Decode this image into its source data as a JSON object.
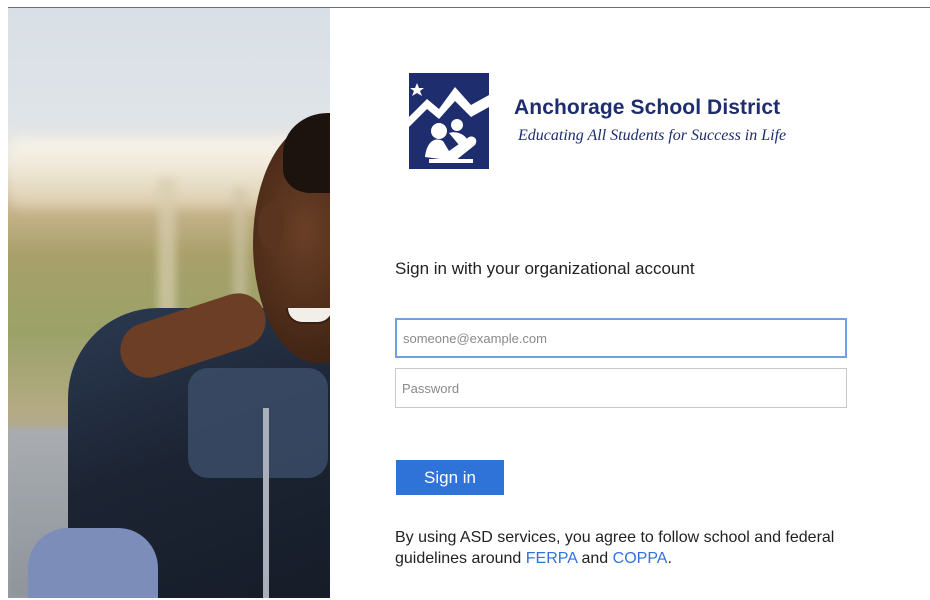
{
  "org": {
    "name": "Anchorage School District",
    "tagline": "Educating All Students for Success in Life"
  },
  "signin": {
    "heading": "Sign in with your organizational account",
    "email_placeholder": "someone@example.com",
    "email_value": "",
    "password_placeholder": "Password",
    "password_value": "",
    "button_label": "Sign in"
  },
  "notice": {
    "text_before": "By using ASD services, you agree to follow school and federal guidelines around ",
    "link1": "FERPA",
    "text_mid": " and ",
    "link2": "COPPA",
    "text_after": "."
  },
  "colors": {
    "brand_navy": "#1e2d6e",
    "accent_blue": "#2f73d8",
    "focus_border": "#6ea1dd"
  },
  "icons": {
    "logo": "asd-mountain-logo"
  }
}
